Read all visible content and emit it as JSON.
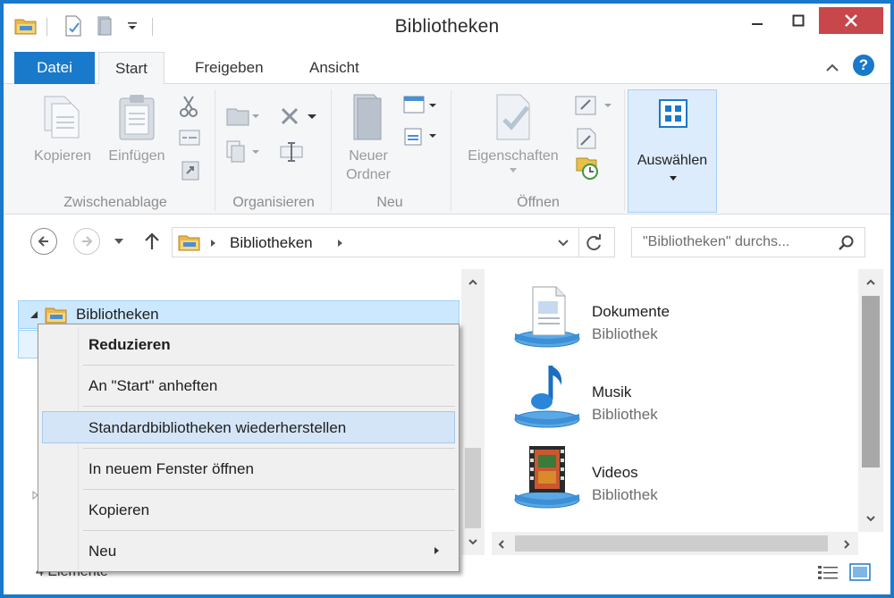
{
  "window": {
    "title": "Bibliotheken",
    "accent": "#1979ca",
    "close_color": "#c7474b"
  },
  "quick_access": {
    "icons": [
      "folder-icon",
      "properties-icon",
      "new-folder-icon",
      "qat-dropdown-icon"
    ]
  },
  "tabs": [
    {
      "label": "Datei"
    },
    {
      "label": "Start"
    },
    {
      "label": "Freigeben"
    },
    {
      "label": "Ansicht"
    }
  ],
  "help_label": "?",
  "ribbon": {
    "groups": [
      {
        "label": "Zwischenablage"
      },
      {
        "label": "Organisieren"
      },
      {
        "label": "Neu"
      },
      {
        "label": "Öffnen"
      }
    ],
    "kopieren": "Kopieren",
    "einfuegen": "Einfügen",
    "neuer_ordner_1": "Neuer",
    "neuer_ordner_2": "Ordner",
    "eigenschaften": "Eigenschaften",
    "auswaehlen": "Auswählen"
  },
  "address": {
    "path": "Bibliotheken",
    "search_placeholder": "\"Bibliotheken\" durchs..."
  },
  "tree": {
    "root_label": "Bibliotheken"
  },
  "libraries": [
    {
      "name": "Dokumente",
      "type": "Bibliothek",
      "icon": "documents-library-icon"
    },
    {
      "name": "Musik",
      "type": "Bibliothek",
      "icon": "music-library-icon"
    },
    {
      "name": "Videos",
      "type": "Bibliothek",
      "icon": "videos-library-icon"
    }
  ],
  "status": {
    "text": "4 Elemente"
  },
  "context_menu": {
    "items": [
      {
        "label": "Reduzieren",
        "bold": true
      },
      {
        "label": "An \"Start\" anheften"
      },
      {
        "label": "Standardbibliotheken wiederherstellen",
        "highlighted": true
      },
      {
        "label": "In neuem Fenster öffnen"
      },
      {
        "label": "Kopieren"
      },
      {
        "label": "Neu",
        "submenu": true
      }
    ]
  }
}
